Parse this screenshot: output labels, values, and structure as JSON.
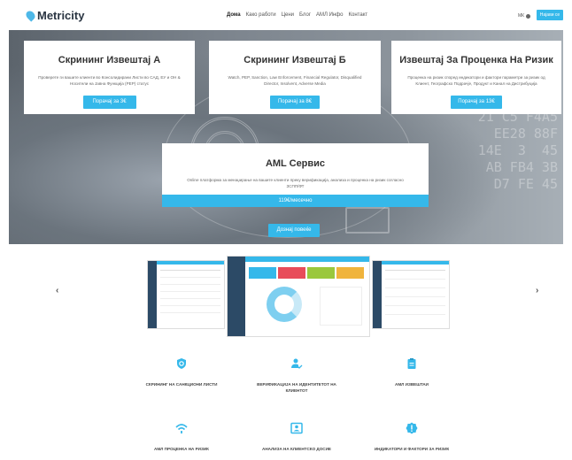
{
  "header": {
    "logo_text": "Metricity",
    "menu": [
      "Дома",
      "Како работи",
      "Цени",
      "Блог",
      "АМЛ Инфо",
      "Контакт"
    ],
    "language": "МК",
    "signin_label": "Најави се"
  },
  "cards": [
    {
      "title": "Скрининг Извештај А",
      "desc": "Проверете ги вашите клиенти во Консолидирани Листи во САД, ЕУ и ОН & Носители на Јавна Функција (PEP) статус",
      "button": "Порачај за 3€"
    },
    {
      "title": "Скрининг Извештај Б",
      "desc": "Watch, PEP, Sanction, Law Enforcement, Financial Regulator, Disqualified Director, Insolvent, Adverse Media",
      "button": "Порачај за 8€"
    },
    {
      "title": "Извештај За Проценка На Ризик",
      "desc": "Проценка на ризик според индикатори и фактори параметри за ризик од Клиент, Географско Подрачје, Продукт и Канал на Дистрибуција",
      "button": "Порачај за 13€"
    }
  ],
  "aml_service": {
    "title": "AML Сервис",
    "desc": "Online платформа за менаџирање на вашите клиенти преку верификација, анализа и проценка на ризик согласно ЗСПП/ФТ",
    "price": "119€/месечно",
    "more_button": "Дознај повеќе"
  },
  "carousel": {
    "prev_icon": "chevron-left-icon",
    "next_icon": "chevron-right-icon"
  },
  "features": [
    {
      "icon": "shield-search-icon",
      "label": "СКРИНИНГ НА САНКЦИОНИ ЛИСТИ"
    },
    {
      "icon": "user-check-icon",
      "label": "ВЕРИФИКАЦИЈА НА ИДЕНТИТЕТОТ НА КЛИЕНТОТ"
    },
    {
      "icon": "clipboard-icon",
      "label": "АМЛ ИЗВЕШТАИ"
    },
    {
      "icon": "wifi-signal-icon",
      "label": "АМЛ ПРОЦЕНКА НА РИЗИК"
    },
    {
      "icon": "id-card-icon",
      "label": "АНАЛИЗА НА КЛИЕНТСКО ДОСИЕ"
    },
    {
      "icon": "alert-badge-icon",
      "label": "ИНДИКАТОРИ И ФАКТОРИ ЗА РИЗИК"
    }
  ],
  "colors": {
    "accent": "#35b8ea",
    "dark_blue": "#2c4a66",
    "text": "#333333"
  }
}
